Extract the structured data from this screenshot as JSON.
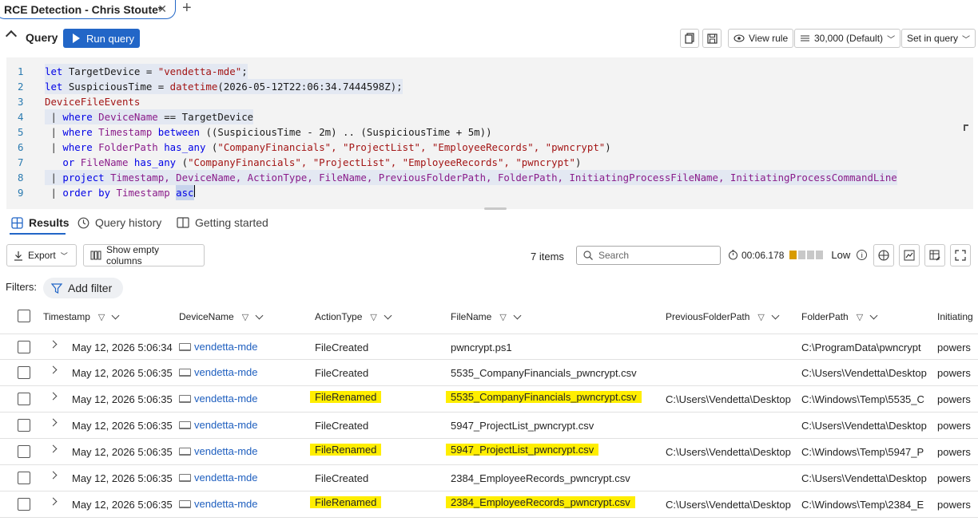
{
  "tab": {
    "title": "RCE Detection - Chris Stoute*"
  },
  "query_bar": {
    "title": "Query",
    "run_label": "Run query",
    "view_rule_label": "View rule",
    "limit_label": "30,000 (Default)",
    "time_label": "Set in query"
  },
  "editor": {
    "line_numbers": [
      "1",
      "2",
      "3",
      "4",
      "5",
      "6",
      "7",
      "8",
      "9"
    ],
    "l1": {
      "kw": "let",
      "name": " TargetDevice = ",
      "val": "\"vendetta-mde\"",
      "end": ";"
    },
    "l2": {
      "kw": "let",
      "name": " SuspiciousTime = ",
      "fn": "datetime",
      "val": "(2026-05-12T22:06:34.7444598Z);"
    },
    "l3": {
      "tbl": "DeviceFileEvents"
    },
    "l4": {
      "pipe": " | ",
      "kw": "where",
      "field": " DeviceName",
      "rest": " == TargetDevice"
    },
    "l5": {
      "pipe": " | ",
      "kw": "where",
      "field": " Timestamp",
      "kw2": " between",
      "rest": " ((SuspiciousTime - 2m) .. (SuspiciousTime + 5m))"
    },
    "l6": {
      "pipe": " | ",
      "kw": "where",
      "field": " FolderPath",
      "kw2": " has_any",
      "rest": " (",
      "vals": "\"CompanyFinancials\", \"ProjectList\", \"EmployeeRecords\", \"pwncrypt\"",
      "end": ")"
    },
    "l7": {
      "indent": "   ",
      "kw": "or",
      "field": " FileName",
      "kw2": " has_any",
      "rest": " (",
      "vals": "\"CompanyFinancials\", \"ProjectList\", \"EmployeeRecords\", \"pwncrypt\"",
      "end": ")"
    },
    "l8": {
      "pipe": " | ",
      "kw": "project",
      "rest": " Timestamp, DeviceName, ActionType, FileName, PreviousFolderPath, FolderPath, InitiatingProcessFileName, InitiatingProcessCommandLine"
    },
    "l9": {
      "pipe": " | ",
      "kw": "order by",
      "rest": " Timestamp ",
      "kw2": "asc"
    }
  },
  "result_tabs": [
    {
      "label": "Results",
      "icon": "grid-icon"
    },
    {
      "label": "Query history",
      "icon": "clock-icon"
    },
    {
      "label": "Getting started",
      "icon": "book-icon"
    }
  ],
  "results_bar": {
    "export_label": "Export",
    "show_empty_label": "Show empty columns",
    "items_count": "7 items",
    "search_placeholder": "Search",
    "elapsed": "00:06.178",
    "perf_label": "Low",
    "perf_bars_on": 1,
    "perf_bars_total": 4
  },
  "filters": {
    "label": "Filters:",
    "add_label": "Add filter"
  },
  "columns": [
    "Timestamp",
    "DeviceName",
    "ActionType",
    "FileName",
    "PreviousFolderPath",
    "FolderPath",
    "Initiating"
  ],
  "rows": [
    {
      "timestamp": "May 12, 2026 5:06:34",
      "device": "vendetta-mde",
      "action": "FileCreated",
      "file": "pwncrypt.ps1",
      "prev": "",
      "folder": "C:\\ProgramData\\pwncrypt",
      "init": "powers",
      "highlight": false
    },
    {
      "timestamp": "May 12, 2026 5:06:35",
      "device": "vendetta-mde",
      "action": "FileCreated",
      "file": "5535_CompanyFinancials_pwncrypt.csv",
      "prev": "",
      "folder": "C:\\Users\\Vendetta\\Desktop",
      "init": "powers",
      "highlight": false
    },
    {
      "timestamp": "May 12, 2026 5:06:35",
      "device": "vendetta-mde",
      "action": "FileRenamed",
      "file": "5535_CompanyFinancials_pwncrypt.csv",
      "prev": "C:\\Users\\Vendetta\\Desktop",
      "folder": "C:\\Windows\\Temp\\5535_C",
      "init": "powers",
      "highlight": true
    },
    {
      "timestamp": "May 12, 2026 5:06:35",
      "device": "vendetta-mde",
      "action": "FileCreated",
      "file": "5947_ProjectList_pwncrypt.csv",
      "prev": "",
      "folder": "C:\\Users\\Vendetta\\Desktop",
      "init": "powers",
      "highlight": false
    },
    {
      "timestamp": "May 12, 2026 5:06:35",
      "device": "vendetta-mde",
      "action": "FileRenamed",
      "file": "5947_ProjectList_pwncrypt.csv",
      "prev": "C:\\Users\\Vendetta\\Desktop",
      "folder": "C:\\Windows\\Temp\\5947_P",
      "init": "powers",
      "highlight": true
    },
    {
      "timestamp": "May 12, 2026 5:06:35",
      "device": "vendetta-mde",
      "action": "FileCreated",
      "file": "2384_EmployeeRecords_pwncrypt.csv",
      "prev": "",
      "folder": "C:\\Users\\Vendetta\\Desktop",
      "init": "powers",
      "highlight": false
    },
    {
      "timestamp": "May 12, 2026 5:06:35",
      "device": "vendetta-mde",
      "action": "FileRenamed",
      "file": "2384_EmployeeRecords_pwncrypt.csv",
      "prev": "C:\\Users\\Vendetta\\Desktop",
      "folder": "C:\\Windows\\Temp\\2384_E",
      "init": "powers",
      "highlight": true
    }
  ],
  "colors": {
    "accent": "#2266c7",
    "highlight": "#ffee00",
    "link": "#1f5fbf"
  }
}
